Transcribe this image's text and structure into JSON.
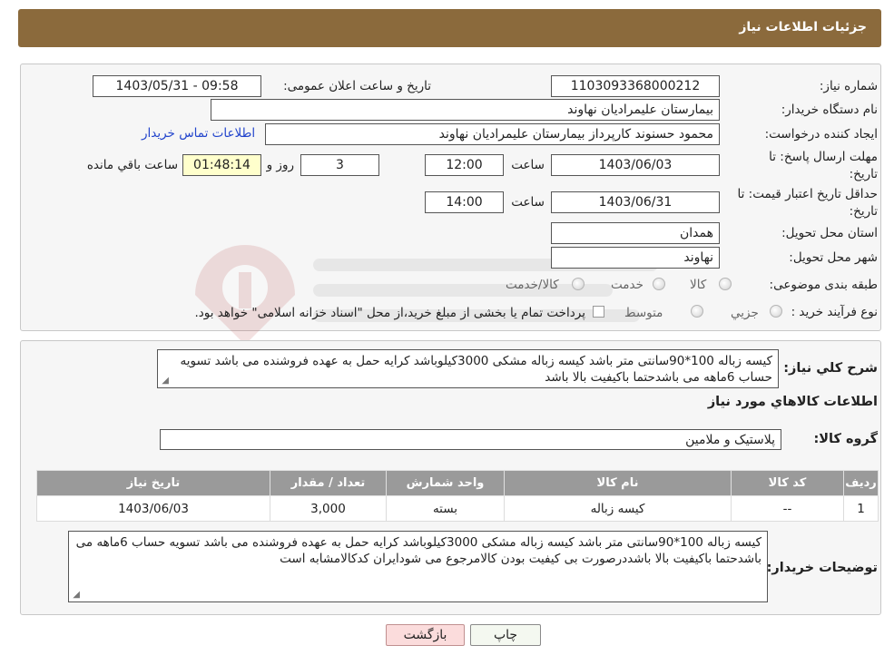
{
  "header": {
    "title": "جزئیات اطلاعات نیاز"
  },
  "form": {
    "need_number": {
      "label": "شماره نیاز:",
      "value": "1103093368000212"
    },
    "announce_datetime": {
      "label": "تاریخ و ساعت اعلان عمومی:",
      "value": "1403/05/31 - 09:58"
    },
    "buyer_org": {
      "label": "نام دستگاه خریدار:",
      "value": "بیمارستان علیمرادیان نهاوند"
    },
    "requester": {
      "label": "ایجاد کننده درخواست:",
      "value": "محمود حسنوند کارپرداز بیمارستان علیمرادیان نهاوند",
      "contact_link": "اطلاعات تماس خریدار"
    },
    "reply_deadline": {
      "label_line1": "مهلت ارسال پاسخ: تا",
      "label_line2": "تاریخ:",
      "date": "1403/06/03",
      "time_label": "ساعت",
      "time": "12:00",
      "days": "3",
      "days_label": "روز و",
      "remaining": "01:48:14",
      "remaining_label": "ساعت باقي مانده"
    },
    "price_validity": {
      "label_line1": "حداقل تاریخ اعتبار قیمت: تا",
      "label_line2": "تاریخ:",
      "date": "1403/06/31",
      "time_label": "ساعت",
      "time": "14:00"
    },
    "province": {
      "label": "استان محل تحویل:",
      "value": "همدان"
    },
    "city": {
      "label": "شهر محل تحویل:",
      "value": "نهاوند"
    },
    "category": {
      "label": "طبقه بندی موضوعی:",
      "options": [
        "کالا",
        "خدمت",
        "کالا/خدمت"
      ]
    },
    "process_type": {
      "label": "نوع فرآیند خرید :",
      "options": [
        "جزیي",
        "متوسط"
      ],
      "note": "پرداخت تمام یا بخشی از مبلغ خرید،از محل \"اسناد خزانه اسلامی\" خواهد بود."
    }
  },
  "need_desc": {
    "label": "شرح کلي نیاز:",
    "text": "کیسه زباله 100*90سانتی متر باشد کیسه زباله مشکی  3000کیلوباشد کرایه حمل به عهده فروشنده می باشد تسویه حساب 6ماهه می باشدحتما باکیفیت بالا باشد"
  },
  "goods": {
    "title": "اطلاعات کالاهاي مورد نیاز",
    "group_label": "گروه کالا:",
    "group_value": "پلاستیک و ملامین",
    "columns": [
      "ردیف",
      "کد کالا",
      "نام کالا",
      "واحد شمارش",
      "تعداد / مقدار",
      "تاریخ نیاز"
    ],
    "rows": [
      [
        "1",
        "--",
        "کیسه زباله",
        "بسته",
        "3,000",
        "1403/06/03"
      ]
    ]
  },
  "buyer_notes": {
    "label": "توضیحات خریدار:",
    "text": "کیسه زباله 100*90سانتی متر باشد کیسه زباله مشکی  3000کیلوباشد کرایه حمل به عهده فروشنده می باشد تسویه حساب 6ماهه می باشدحتما باکیفیت بالا باشددرصورت بی کیفیت بودن کالامرجوع می شودایران کدکالامشابه است"
  },
  "buttons": {
    "print": "چاپ",
    "back": "بازگشت"
  },
  "colors": {
    "header": "#8b6a3c",
    "table_header": "#9a9a9a",
    "link": "#2244cc",
    "back_button": "#fbdcdc"
  }
}
